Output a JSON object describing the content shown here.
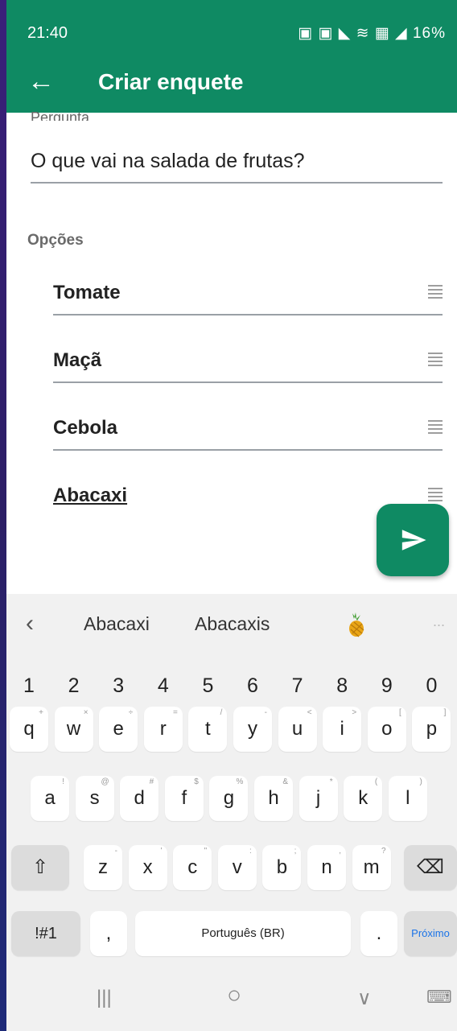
{
  "status": {
    "time": "21:40",
    "battery": "16%",
    "icons": "▣ ▣ ◣ ≋ ▦ ◢"
  },
  "appbar": {
    "back_icon": "arrow-left",
    "title": "Criar enquete"
  },
  "question": {
    "label": "Pergunta",
    "value": "O que vai na salada de frutas?"
  },
  "options_label": "Opções",
  "options": [
    "Tomate",
    "Maçã",
    "Cebola",
    "Abacaxi"
  ],
  "fab": {
    "icon": "send"
  },
  "keyboard": {
    "suggestions": [
      "Abacaxi",
      "Abacaxis"
    ],
    "suggestion_emoji": "pineapple",
    "more": "...",
    "numbers": [
      "1",
      "2",
      "3",
      "4",
      "5",
      "6",
      "7",
      "8",
      "9",
      "0"
    ],
    "row1": [
      "q",
      "w",
      "e",
      "r",
      "t",
      "y",
      "u",
      "i",
      "o",
      "p"
    ],
    "row1_hints": [
      "+",
      "×",
      "÷",
      "=",
      "/",
      "-",
      "<",
      ">",
      "[",
      "]"
    ],
    "row2": [
      "a",
      "s",
      "d",
      "f",
      "g",
      "h",
      "j",
      "k",
      "l"
    ],
    "row2_hints": [
      "!",
      "@",
      "#",
      "$",
      "%",
      "&",
      "*",
      "(",
      ")"
    ],
    "row3": [
      "z",
      "x",
      "c",
      "v",
      "b",
      "n",
      "m"
    ],
    "row3_hints": [
      "-",
      "'",
      "\"",
      ":",
      ";",
      ",",
      "?"
    ],
    "symbols": "!#1",
    "comma": ",",
    "space": "Português (BR)",
    "period": ".",
    "next": "Próximo"
  },
  "navbar": {
    "recent": "|||",
    "home": "○",
    "back": "∨",
    "keyboard": "⌨"
  },
  "colors": {
    "accent": "#0f8a63",
    "next_key": "#1a73e8"
  }
}
